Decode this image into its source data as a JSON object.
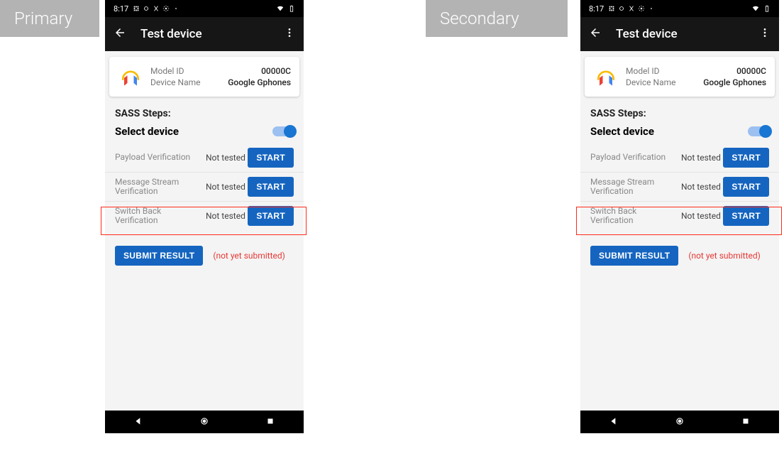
{
  "labels": {
    "primary": "Primary",
    "secondary": "Secondary"
  },
  "status": {
    "time": "8:17"
  },
  "appbar": {
    "title": "Test device"
  },
  "device": {
    "model_id_label": "Model ID",
    "model_id": "00000C",
    "name_label": "Device Name",
    "name": "Google Gphones"
  },
  "sections": {
    "sass": "SASS Steps:",
    "select": "Select device"
  },
  "tests": [
    {
      "name": "Payload Verification",
      "status": "Not tested",
      "btn": "START"
    },
    {
      "name": "Message Stream Verification",
      "status": "Not tested",
      "btn": "START"
    },
    {
      "name": "Switch Back Verification",
      "status": "Not tested",
      "btn": "START"
    }
  ],
  "submit": {
    "btn": "SUBMIT RESULT",
    "note": "(not yet submitted)"
  }
}
